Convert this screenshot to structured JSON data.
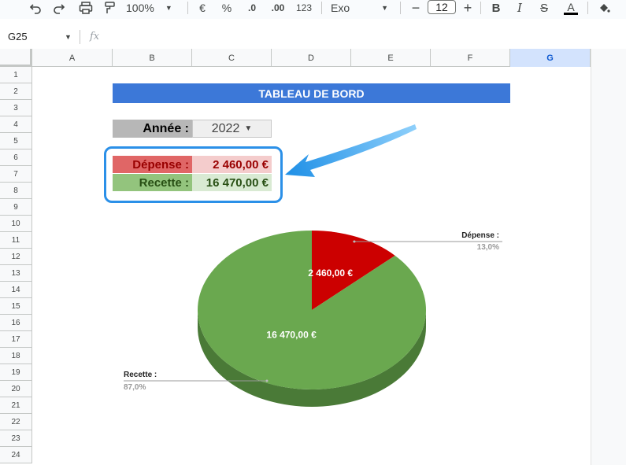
{
  "toolbar": {
    "zoom": "100%",
    "currency_symbol": "€",
    "percent_symbol": "%",
    "decrease_decimals": ".0",
    "increase_decimals": ".00",
    "number_format": "123",
    "font_name": "Exo",
    "font_size": "12",
    "bold": "B",
    "italic": "I",
    "strikethrough": "S",
    "text_color": "A"
  },
  "formula_bar": {
    "cell_ref": "G25",
    "fx": "fx"
  },
  "columns": [
    "A",
    "B",
    "C",
    "D",
    "E",
    "F",
    "G"
  ],
  "active_column": "G",
  "rows": [
    "1",
    "2",
    "3",
    "4",
    "5",
    "6",
    "7",
    "8",
    "9",
    "10",
    "11",
    "12",
    "13",
    "14",
    "15",
    "16",
    "17",
    "18",
    "19",
    "20",
    "21",
    "22",
    "23",
    "24"
  ],
  "dashboard": {
    "title": "TABLEAU DE BORD",
    "annee_label": "Année :",
    "annee_value": "2022",
    "depense_label": "Dépense :",
    "depense_value": "2 460,00 €",
    "recette_label": "Recette  :",
    "recette_value": "16 470,00 €"
  },
  "colors": {
    "title_bg": "#3c78d8",
    "depense_red": "#cc0000",
    "recette_green": "#6aa84f",
    "highlight_blue": "#2b90e8"
  },
  "chart_data": {
    "type": "pie",
    "style": "3d",
    "slices": [
      {
        "label": "Dépense :",
        "value": 2460,
        "value_label": "2 460,00 €",
        "percent_label": "13,0%",
        "color": "#cc0000",
        "side_color": "#990000"
      },
      {
        "label": "Recette  :",
        "value": 16470,
        "value_label": "16 470,00 €",
        "percent_label": "87,0%",
        "color": "#6aa84f",
        "side_color": "#4a7a37"
      }
    ]
  }
}
